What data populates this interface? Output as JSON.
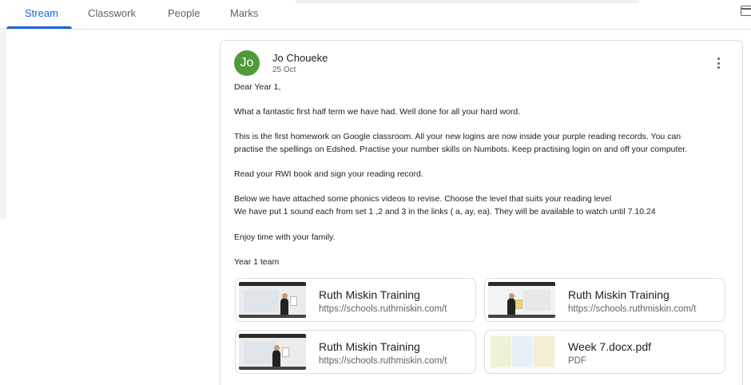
{
  "tabs": [
    {
      "label": "Stream",
      "active": true
    },
    {
      "label": "Classwork",
      "active": false
    },
    {
      "label": "People",
      "active": false
    },
    {
      "label": "Marks",
      "active": false
    }
  ],
  "post": {
    "avatar_initials": "Jo",
    "avatar_color": "#4f9a3a",
    "author": "Jo Choueke",
    "date": "25 Oct",
    "lines": [
      "Dear Year 1,",
      "What a fantastic first half term we have had. Well done for all your hard word.",
      "This is the first homework on Google classroom. All your new logins are now inside your purple reading records. You can",
      "practise the spellings on Edshed. Practise your number skills on Numbots. Keep practising login on and off your computer.",
      "Read your RWI book and sign your reading record.",
      "Below we have attached some phonics videos to revise. Choose the level that suits your reading level",
      "We have put 1 sound each from set 1 ,2 and 3 in the links ( a, ay, ea). They will be available  to watch until 7.10.24",
      "Enjoy time with your family.",
      "Year 1 team"
    ]
  },
  "attachments": [
    {
      "title": "Ruth Miskin Training",
      "subtitle": "https://schools.ruthmiskin.com/t",
      "type": "video"
    },
    {
      "title": "Ruth Miskin Training",
      "subtitle": "https://schools.ruthmiskin.com/t",
      "type": "video"
    },
    {
      "title": "Ruth Miskin Training",
      "subtitle": "https://schools.ruthmiskin.com/t",
      "type": "video"
    },
    {
      "title": "Week 7.docx.pdf",
      "subtitle": "PDF",
      "type": "pdf"
    }
  ],
  "colors": {
    "accent": "#1967d2",
    "border": "#dadce0"
  }
}
